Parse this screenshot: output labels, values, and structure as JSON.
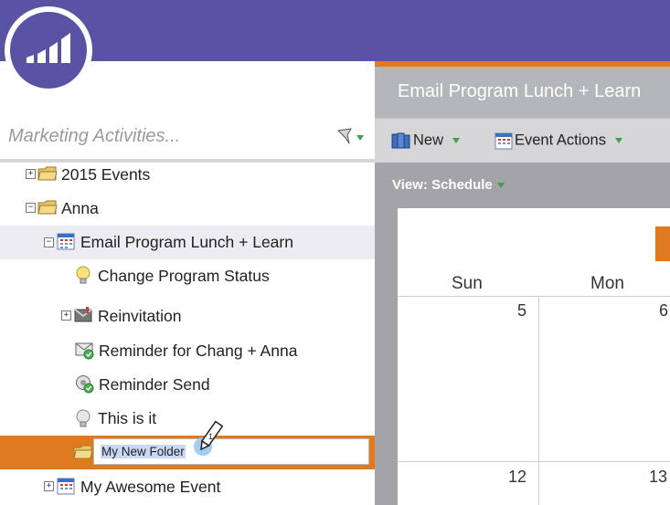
{
  "logo": {
    "icon": "marketo-logo-icon"
  },
  "search": {
    "placeholder": "Marketing Activities..."
  },
  "tree": {
    "items": [
      {
        "label": "2015 Events"
      },
      {
        "label": "Anna"
      },
      {
        "label": "Email Program Lunch + Learn"
      },
      {
        "label": "Change Program Status"
      },
      {
        "label": "Reinvitation"
      },
      {
        "label": "Reminder for Chang + Anna"
      },
      {
        "label": "Reminder Send"
      },
      {
        "label": "This is it"
      },
      {
        "label": "My Awesome Event"
      }
    ],
    "editing": {
      "value": "My New Folder",
      "step_badge": "1"
    }
  },
  "program": {
    "title": "Email Program Lunch + Learn",
    "toolbar": {
      "new_label": "New",
      "event_actions_label": "Event Actions"
    },
    "view_label": "View: Schedule"
  },
  "calendar": {
    "days": [
      "Sun",
      "Mon"
    ],
    "week1": [
      "5",
      "6"
    ],
    "week2": [
      "12",
      "13"
    ]
  },
  "colors": {
    "brand": "#5A53A5",
    "accent": "#E07A1F"
  }
}
